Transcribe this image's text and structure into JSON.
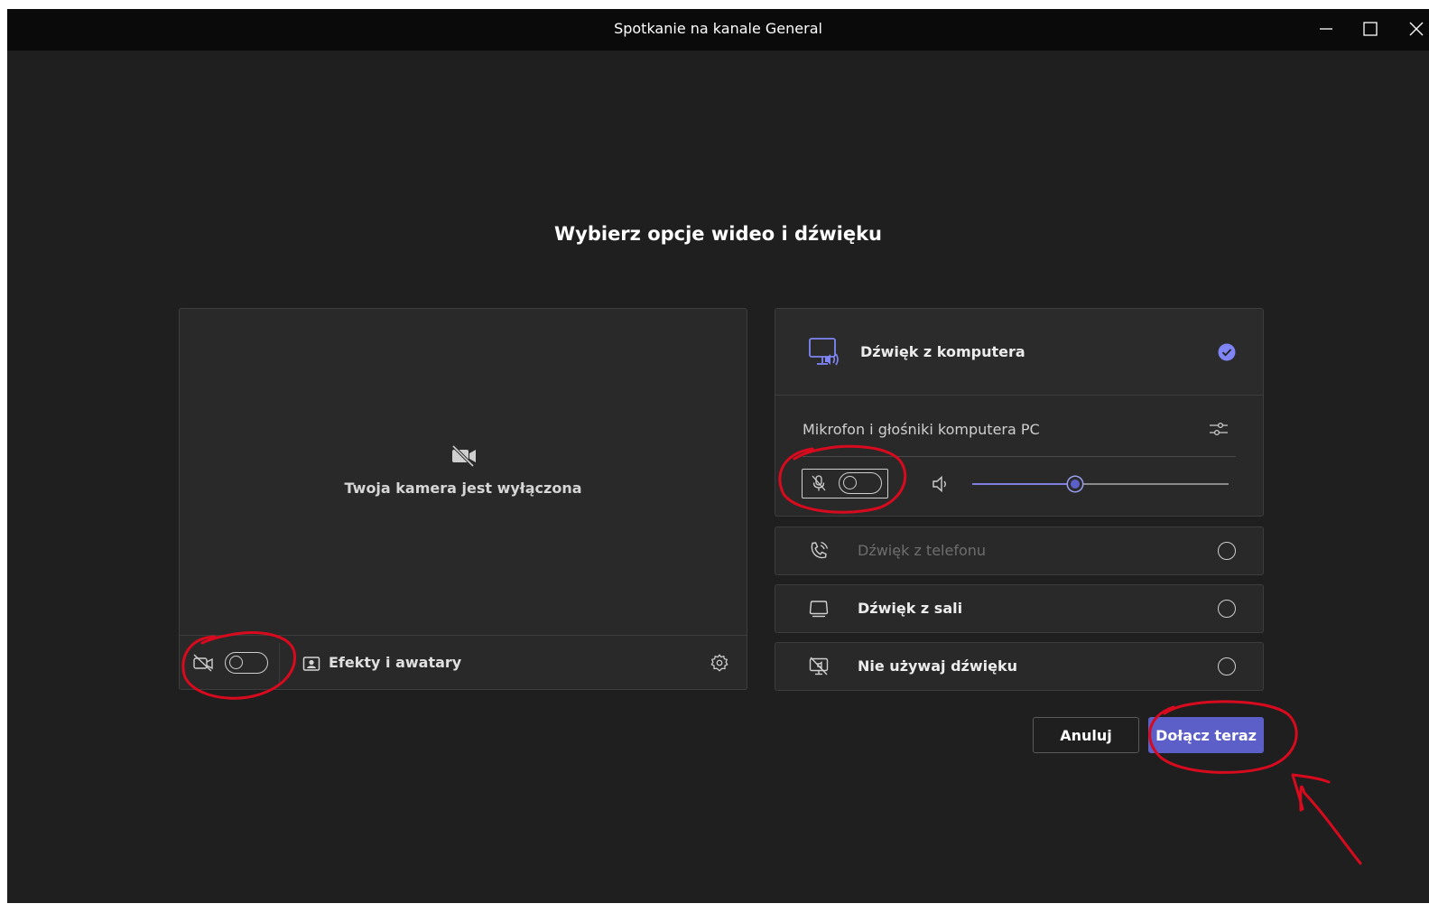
{
  "window": {
    "title": "Spotkanie na kanale General"
  },
  "heading": "Wybierz opcje wideo i dźwięku",
  "video": {
    "camera_off_text": "Twoja kamera jest wyłączona",
    "camera_toggle_on": false,
    "effects_label": "Efekty i awatary"
  },
  "audio": {
    "options": [
      {
        "label": "Dźwięk z komputera",
        "selected": true
      },
      {
        "label": "Dźwięk z telefonu",
        "selected": false,
        "disabled": true
      },
      {
        "label": "Dźwięk z sali",
        "selected": false
      },
      {
        "label": "Nie używaj dźwięku",
        "selected": false
      }
    ],
    "device_label": "Mikrofon i głośniki komputera PC",
    "mic_toggle_on": false,
    "volume_percent": 40
  },
  "buttons": {
    "cancel": "Anuluj",
    "join": "Dołącz teraz"
  },
  "colors": {
    "accent": "#5b5fc7",
    "background": "#1f1f1f",
    "panel": "#292929",
    "annotation": "#d80a1e"
  }
}
